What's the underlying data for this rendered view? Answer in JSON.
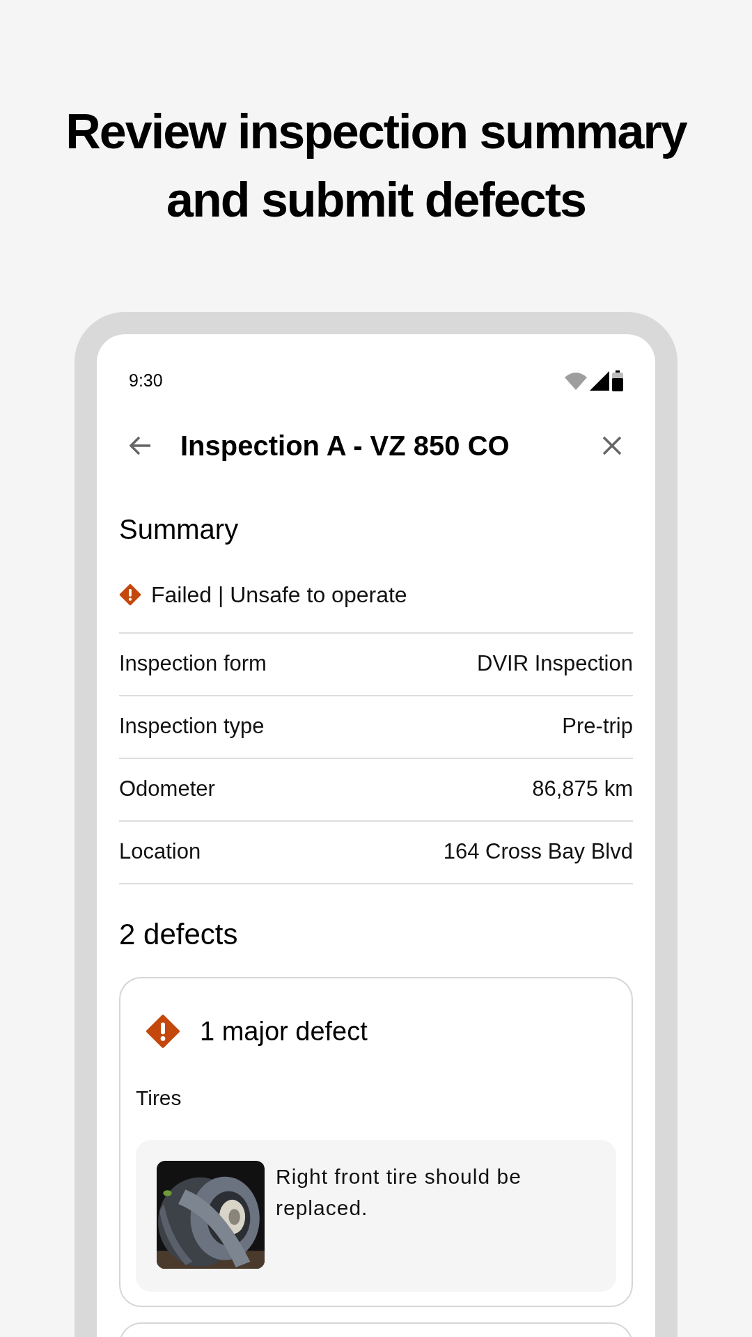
{
  "headline": "Review inspection summary and submit defects",
  "status_bar": {
    "time": "9:30"
  },
  "app_bar": {
    "title": "Inspection A - VZ 850 CO"
  },
  "summary": {
    "title": "Summary",
    "status": {
      "kind": "failed",
      "text": "Failed | Unsafe to operate"
    },
    "rows": [
      {
        "label": "Inspection form",
        "value": "DVIR Inspection"
      },
      {
        "label": "Inspection type",
        "value": "Pre-trip"
      },
      {
        "label": "Odometer",
        "value": "86,875 km"
      },
      {
        "label": "Location",
        "value": "164 Cross Bay Blvd"
      }
    ]
  },
  "defects": {
    "title": "2 defects",
    "groups": [
      {
        "kind": "major",
        "title": "1 major defect",
        "items": [
          {
            "category": "Tires",
            "note": "Right front tire should be replaced."
          }
        ]
      }
    ]
  }
}
